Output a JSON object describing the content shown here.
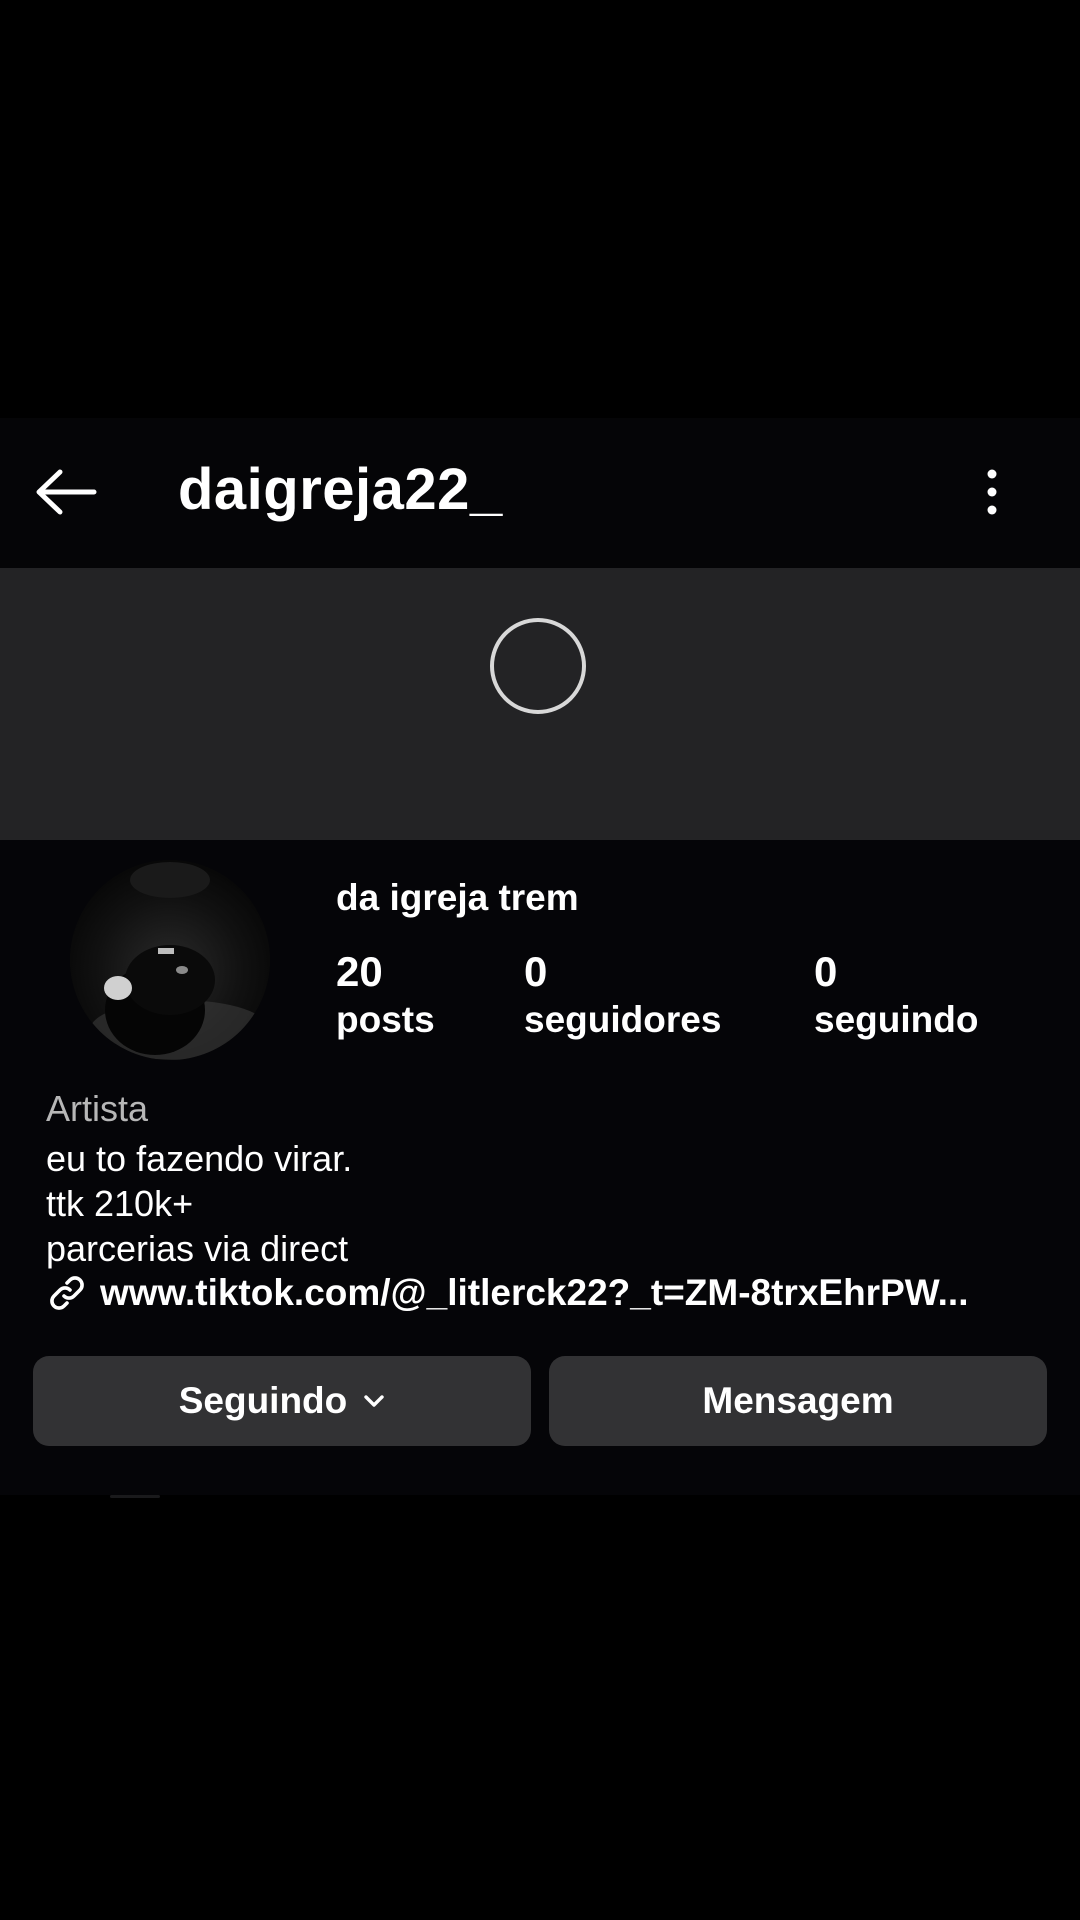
{
  "header": {
    "username": "daigreja22_",
    "back_icon": "arrow-left-icon",
    "more_icon": "more-vertical-icon"
  },
  "cover": {
    "loading_icon": "loading-spinner-icon"
  },
  "profile": {
    "display_name": "da igreja trem",
    "stats": [
      {
        "value": "20",
        "label": "posts"
      },
      {
        "value": "0",
        "label": "seguidores"
      },
      {
        "value": "0",
        "label": "seguindo"
      }
    ],
    "category": "Artista",
    "bio": [
      "eu to fazendo virar.",
      "ttk 210k+",
      "parcerias via direct"
    ],
    "link": {
      "icon": "link-icon",
      "text": "www.tiktok.com/@_litlerck22?_t=ZM-8trxEhrPW..."
    }
  },
  "actions": {
    "following_label": "Seguindo",
    "following_icon": "chevron-down-icon",
    "message_label": "Mensagem"
  },
  "colors": {
    "background": "#000000",
    "cover": "#232325",
    "button": "#323234",
    "category_text": "#b7b7b7"
  }
}
